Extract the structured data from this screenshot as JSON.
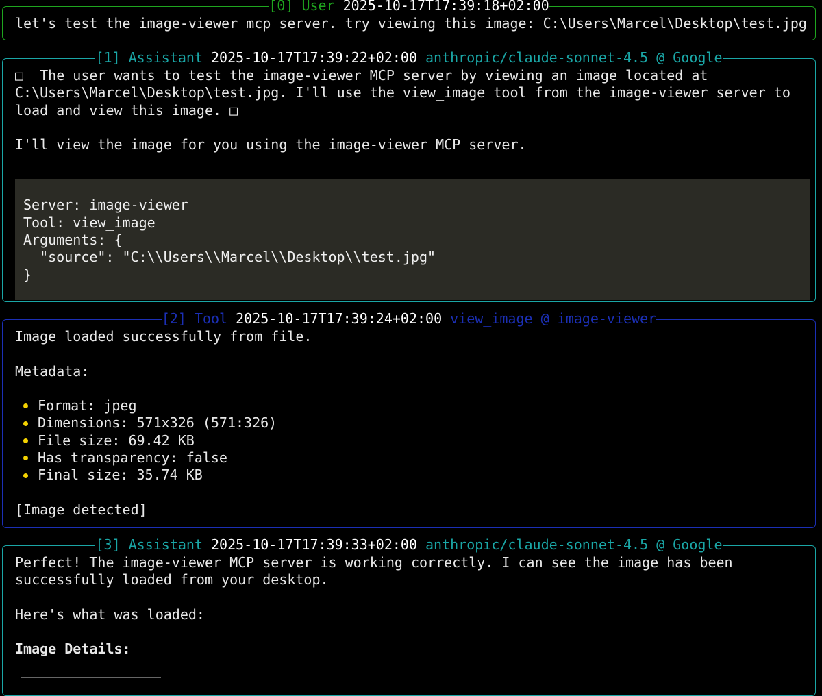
{
  "colors": {
    "background": "#000000",
    "text": "#e8e8e8",
    "user": "#1fa51f",
    "assistant": "#1aa6a6",
    "tool": "#1b2fb5",
    "timestamp": "#ffffff",
    "bullet": "#f3d100",
    "code_bg": "#2b2b25"
  },
  "messages": [
    {
      "index": "[0]",
      "role": "User",
      "timestamp": "2025-10-17T17:39:18+02:00",
      "lines": [
        "let's test the image-viewer mcp server. try viewing this image: C:\\Users\\Marcel\\Desktop\\test.jpg"
      ]
    },
    {
      "index": "[1]",
      "role": "Assistant",
      "timestamp": "2025-10-17T17:39:22+02:00",
      "model": "anthropic/claude-sonnet-4.5 @ Google",
      "thinking_lines": [
        "□  The user wants to test the image-viewer MCP server by viewing an image located at",
        "C:\\Users\\Marcel\\Desktop\\test.jpg. I'll use the view_image tool from the image-viewer server to",
        "load and view this image. □"
      ],
      "text": "I'll view the image for you using the image-viewer MCP server.",
      "tool_call": [
        "Server: image-viewer",
        "Tool: view_image",
        "Arguments: {",
        "  \"source\": \"C:\\\\Users\\\\Marcel\\\\Desktop\\\\test.jpg\"",
        "}"
      ]
    },
    {
      "index": "[2]",
      "role": "Tool",
      "timestamp": "2025-10-17T17:39:24+02:00",
      "tool_ref": "view_image @ image-viewer",
      "line1": "Image loaded successfully from file.",
      "line2": "Metadata:",
      "bullets": [
        "Format: jpeg",
        "Dimensions: 571x326 (571:326)",
        "File size: 69.42 KB",
        "Has transparency: false",
        "Final size: 35.74 KB"
      ],
      "line3": "[Image detected]"
    },
    {
      "index": "[3]",
      "role": "Assistant",
      "timestamp": "2025-10-17T17:39:33+02:00",
      "model": "anthropic/claude-sonnet-4.5 @ Google",
      "lines": [
        "Perfect! The image-viewer MCP server is working correctly. I can see the image has been",
        "successfully loaded from your desktop."
      ],
      "line_loaded": "Here's what was loaded:",
      "heading": "Image Details:"
    }
  ]
}
